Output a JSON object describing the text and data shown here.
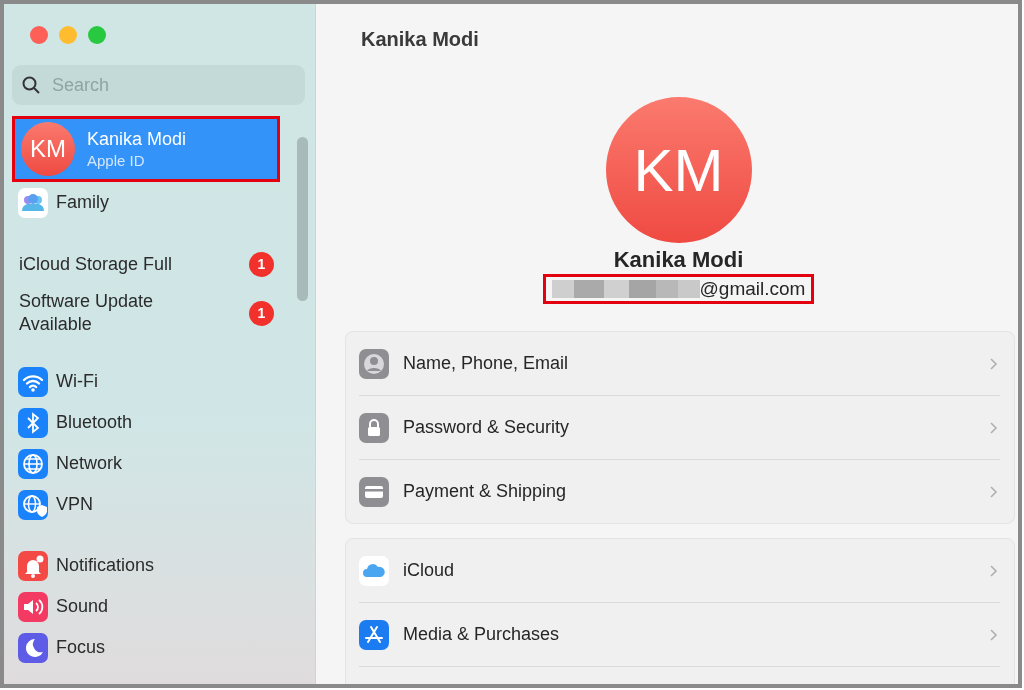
{
  "window": {
    "title": "Kanika Modi"
  },
  "sidebar": {
    "search": {
      "placeholder": "Search"
    },
    "items": [
      {
        "kind": "account",
        "initials": "KM",
        "label": "Kanika Modi",
        "sublabel": "Apple ID",
        "selected": true,
        "annotated": true
      },
      {
        "kind": "app",
        "label": "Family",
        "selected": false
      },
      {
        "kind": "gap"
      },
      {
        "kind": "alert",
        "label": "iCloud Storage Full",
        "badge": "1",
        "selected": false
      },
      {
        "kind": "alert",
        "label": "Software Update Available",
        "badge": "1",
        "selected": false
      },
      {
        "kind": "gap"
      },
      {
        "kind": "app",
        "label": "Wi-Fi",
        "color": "#1a82fb",
        "selected": false
      },
      {
        "kind": "app",
        "label": "Bluetooth",
        "color": "#1a82fb",
        "selected": false
      },
      {
        "kind": "app",
        "label": "Network",
        "color": "#1a82fb",
        "selected": false
      },
      {
        "kind": "app",
        "label": "VPN",
        "color": "#1a82fb",
        "selected": false
      },
      {
        "kind": "gap"
      },
      {
        "kind": "app",
        "label": "Notifications",
        "color": "#f44a45",
        "selected": false
      },
      {
        "kind": "app",
        "label": "Sound",
        "color": "#f33a62",
        "selected": false
      },
      {
        "kind": "app",
        "label": "Focus",
        "color": "#5e5ce6",
        "selected": false
      }
    ]
  },
  "profile": {
    "initials": "KM",
    "name": "Kanika Modi",
    "email": "@gmail.com",
    "email_redacted": true,
    "annotated": true
  },
  "groups": [
    [
      {
        "label": "Name, Phone, Email"
      },
      {
        "label": "Password & Security"
      },
      {
        "label": "Payment & Shipping"
      }
    ],
    [
      {
        "label": "iCloud"
      },
      {
        "label": "Media & Purchases"
      }
    ]
  ]
}
